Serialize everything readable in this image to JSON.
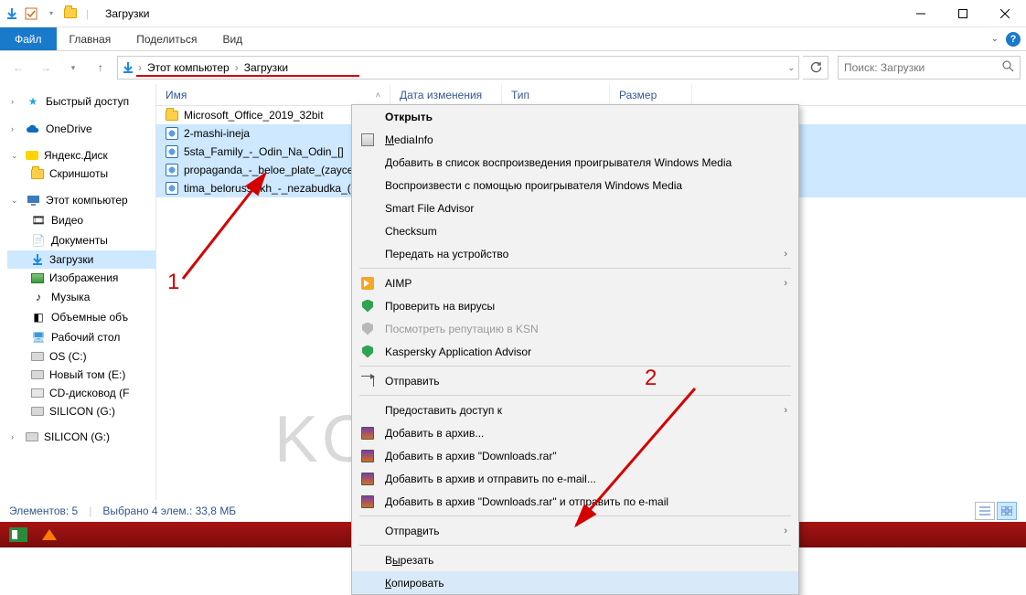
{
  "window": {
    "title": "Загрузки"
  },
  "ribbon": {
    "file": "Файл",
    "tabs": [
      "Главная",
      "Поделиться",
      "Вид"
    ]
  },
  "breadcrumb": {
    "root": "Этот компьютер",
    "current": "Загрузки"
  },
  "search": {
    "placeholder": "Поиск: Загрузки"
  },
  "columns": {
    "name": "Имя",
    "date": "Дата изменения",
    "type": "Тип",
    "size": "Размер"
  },
  "sidebar": {
    "quick": "Быстрый доступ",
    "onedrive": "OneDrive",
    "yadisk": "Яндекс.Диск",
    "yadisk_child": "Скриншоты",
    "thispc": "Этот компьютер",
    "pc_items": [
      "Видео",
      "Документы",
      "Загрузки",
      "Изображения",
      "Музыка",
      "Объемные объ",
      "Рабочий стол",
      "OS (C:)",
      "Новый том (E:)",
      "CD-дисковод (F",
      "SILICON (G:)"
    ],
    "extra": "SILICON (G:)"
  },
  "files": [
    {
      "name": "Microsoft_Office_2019_32bit",
      "type": "folder",
      "selected": false
    },
    {
      "name": "2-mashi-ineja",
      "type": "wma",
      "selected": true
    },
    {
      "name": "5sta_Family_-_Odin_Na_Odin_[]",
      "type": "wma",
      "selected": true
    },
    {
      "name": "propaganda_-_beloe_plate_(zaycev",
      "type": "wma",
      "selected": true
    },
    {
      "name": "tima_belorusskikh_-_nezabudka_(z",
      "type": "wma",
      "selected": true
    }
  ],
  "context_menu": {
    "open": "Открыть",
    "mediainfo": "MediaInfo",
    "add_wmp_list": "Добавить в список воспроизведения проигрывателя Windows Media",
    "play_wmp": "Воспроизвести с помощью проигрывателя Windows Media",
    "sfa": "Smart File Advisor",
    "checksum": "Checksum",
    "cast": "Передать на устройство",
    "aimp": "AIMP",
    "scan": "Проверить на вирусы",
    "ksn": "Посмотреть репутацию в KSN",
    "kaa": "Kaspersky Application Advisor",
    "send": "Отправить",
    "share": "Предоставить доступ к",
    "rar_add": "Добавить в архив...",
    "rar_add_dl": "Добавить в архив \"Downloads.rar\"",
    "rar_email": "Добавить в архив и отправить по e-mail...",
    "rar_dl_email": "Добавить в архив \"Downloads.rar\" и отправить по e-mail",
    "send2": "Отправить",
    "cut": "Вырезать",
    "copy": "Копировать"
  },
  "status": {
    "count": "Элементов: 5",
    "selected": "Выбрано 4 элем.: 33,8 МБ"
  },
  "annotations": {
    "one": "1",
    "two": "2"
  },
  "watermark": "KONEKTO.RU"
}
